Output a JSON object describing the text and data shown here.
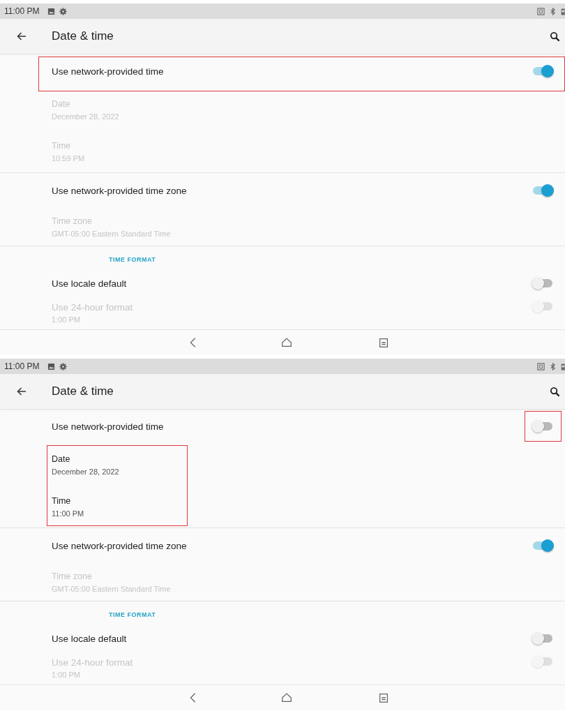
{
  "panels": [
    {
      "status_bar": {
        "time": "11:00 PM"
      },
      "title": "Date & time",
      "categories": [
        {
          "items": [
            {
              "kind": "switch",
              "title": "Use network-provided time",
              "on": true,
              "disabled": false,
              "highlighted": true,
              "switch_highlighted": false
            },
            {
              "kind": "info",
              "title": "Date",
              "summary": "December 28, 2022",
              "disabled": true
            },
            {
              "kind": "info",
              "title": "Time",
              "summary": "10:59 PM",
              "disabled": true
            }
          ]
        },
        {
          "items": [
            {
              "kind": "switch",
              "title": "Use network-provided time zone",
              "on": true,
              "disabled": false,
              "highlighted": false,
              "switch_highlighted": false
            },
            {
              "kind": "info",
              "title": "Time zone",
              "summary": "GMT-05:00 Eastern Standard Time",
              "disabled": true
            }
          ]
        },
        {
          "header": "TIME FORMAT",
          "items": [
            {
              "kind": "switch",
              "title": "Use locale default",
              "on": false,
              "disabled": false,
              "highlighted": false,
              "switch_highlighted": false
            },
            {
              "kind": "switch",
              "title": "Use 24-hour format",
              "summary": "1:00 PM",
              "on": false,
              "disabled": true,
              "highlighted": false,
              "switch_highlighted": false
            }
          ]
        }
      ]
    },
    {
      "status_bar": {
        "time": "11:00 PM"
      },
      "title": "Date & time",
      "categories": [
        {
          "items": [
            {
              "kind": "switch",
              "title": "Use network-provided time",
              "on": false,
              "disabled": false,
              "highlighted": false,
              "switch_highlighted": true
            },
            {
              "kind": "group",
              "highlighted": true,
              "children": [
                {
                  "kind": "info",
                  "title": "Date",
                  "summary": "December 28, 2022",
                  "disabled": false
                },
                {
                  "kind": "info",
                  "title": "Time",
                  "summary": "11:00 PM",
                  "disabled": false
                }
              ]
            }
          ]
        },
        {
          "items": [
            {
              "kind": "switch",
              "title": "Use network-provided time zone",
              "on": true,
              "disabled": false,
              "highlighted": false,
              "switch_highlighted": false
            },
            {
              "kind": "info",
              "title": "Time zone",
              "summary": "GMT-05:00 Eastern Standard Time",
              "disabled": true
            }
          ]
        },
        {
          "header": "TIME FORMAT",
          "items": [
            {
              "kind": "switch",
              "title": "Use locale default",
              "on": false,
              "disabled": false,
              "highlighted": false,
              "switch_highlighted": false
            },
            {
              "kind": "switch",
              "title": "Use 24-hour format",
              "summary": "1:00 PM",
              "on": false,
              "disabled": true,
              "highlighted": false,
              "switch_highlighted": false
            }
          ]
        }
      ]
    }
  ]
}
